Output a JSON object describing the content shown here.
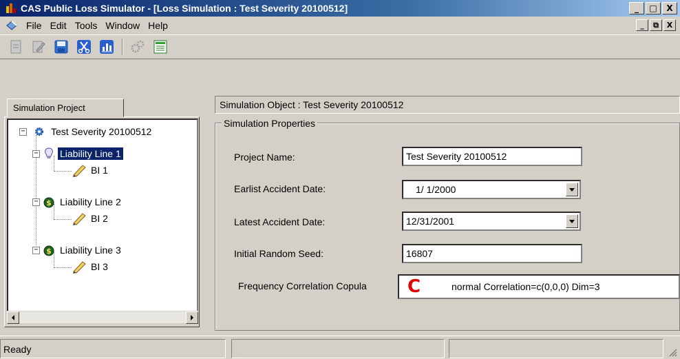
{
  "window": {
    "title": "CAS Public Loss Simulator - [Loss Simulation : Test Severity 20100512]",
    "minimize": "_",
    "maximize": "□",
    "close": "X"
  },
  "menu": {
    "items": [
      "File",
      "Edit",
      "Tools",
      "Window",
      "Help"
    ],
    "mdi_minimize": "_",
    "mdi_restore": "⧉",
    "mdi_close": "X"
  },
  "toolbar": {
    "icons": [
      "new-document-icon",
      "edit-icon",
      "save-icon",
      "cut-icon",
      "chart-icon",
      "gears-icon",
      "export-icon"
    ]
  },
  "left_panel": {
    "tab_label": "Simulation Project",
    "tree": {
      "root": "Test Severity 20100512",
      "lines": [
        {
          "label": "Liability Line 1",
          "child": "BI 1",
          "selected": true
        },
        {
          "label": "Liability Line 2",
          "child": "BI 2",
          "selected": false
        },
        {
          "label": "Liability Line 3",
          "child": "BI 3",
          "selected": false
        }
      ]
    }
  },
  "right_panel": {
    "header": "Simulation Object : Test Severity 20100512",
    "group_title": "Simulation Properties",
    "project_name_label": "Project Name:",
    "project_name_value": "Test Severity 20100512",
    "earliest_label": "Earlist Accident Date:",
    "earliest_value": "1/ 1/2000",
    "latest_label": "Latest Accident Date:",
    "latest_value": "12/31/2001",
    "seed_label": "Initial Random Seed:",
    "seed_value": "16807",
    "copula_label": "Frequency Correlation Copula",
    "copula_icon": "C",
    "copula_value": "normal Correlation=c(0,0,0) Dim=3"
  },
  "status": {
    "text": "Ready"
  }
}
